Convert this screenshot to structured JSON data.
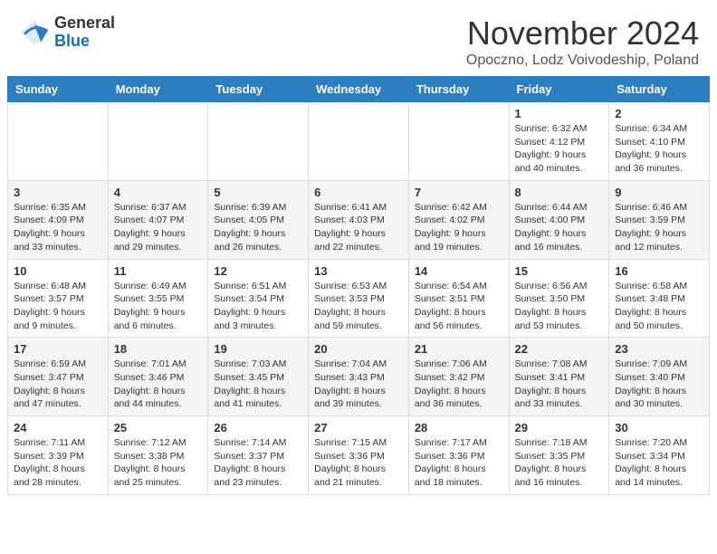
{
  "logo": {
    "general": "General",
    "blue": "Blue"
  },
  "header": {
    "title": "November 2024",
    "subtitle": "Opoczno, Lodz Voivodeship, Poland"
  },
  "columns": [
    "Sunday",
    "Monday",
    "Tuesday",
    "Wednesday",
    "Thursday",
    "Friday",
    "Saturday"
  ],
  "weeks": [
    [
      {
        "day": "",
        "info": ""
      },
      {
        "day": "",
        "info": ""
      },
      {
        "day": "",
        "info": ""
      },
      {
        "day": "",
        "info": ""
      },
      {
        "day": "",
        "info": ""
      },
      {
        "day": "1",
        "info": "Sunrise: 6:32 AM\nSunset: 4:12 PM\nDaylight: 9 hours\nand 40 minutes."
      },
      {
        "day": "2",
        "info": "Sunrise: 6:34 AM\nSunset: 4:10 PM\nDaylight: 9 hours\nand 36 minutes."
      }
    ],
    [
      {
        "day": "3",
        "info": "Sunrise: 6:35 AM\nSunset: 4:09 PM\nDaylight: 9 hours\nand 33 minutes."
      },
      {
        "day": "4",
        "info": "Sunrise: 6:37 AM\nSunset: 4:07 PM\nDaylight: 9 hours\nand 29 minutes."
      },
      {
        "day": "5",
        "info": "Sunrise: 6:39 AM\nSunset: 4:05 PM\nDaylight: 9 hours\nand 26 minutes."
      },
      {
        "day": "6",
        "info": "Sunrise: 6:41 AM\nSunset: 4:03 PM\nDaylight: 9 hours\nand 22 minutes."
      },
      {
        "day": "7",
        "info": "Sunrise: 6:42 AM\nSunset: 4:02 PM\nDaylight: 9 hours\nand 19 minutes."
      },
      {
        "day": "8",
        "info": "Sunrise: 6:44 AM\nSunset: 4:00 PM\nDaylight: 9 hours\nand 16 minutes."
      },
      {
        "day": "9",
        "info": "Sunrise: 6:46 AM\nSunset: 3:59 PM\nDaylight: 9 hours\nand 12 minutes."
      }
    ],
    [
      {
        "day": "10",
        "info": "Sunrise: 6:48 AM\nSunset: 3:57 PM\nDaylight: 9 hours\nand 9 minutes."
      },
      {
        "day": "11",
        "info": "Sunrise: 6:49 AM\nSunset: 3:55 PM\nDaylight: 9 hours\nand 6 minutes."
      },
      {
        "day": "12",
        "info": "Sunrise: 6:51 AM\nSunset: 3:54 PM\nDaylight: 9 hours\nand 3 minutes."
      },
      {
        "day": "13",
        "info": "Sunrise: 6:53 AM\nSunset: 3:53 PM\nDaylight: 8 hours\nand 59 minutes."
      },
      {
        "day": "14",
        "info": "Sunrise: 6:54 AM\nSunset: 3:51 PM\nDaylight: 8 hours\nand 56 minutes."
      },
      {
        "day": "15",
        "info": "Sunrise: 6:56 AM\nSunset: 3:50 PM\nDaylight: 8 hours\nand 53 minutes."
      },
      {
        "day": "16",
        "info": "Sunrise: 6:58 AM\nSunset: 3:48 PM\nDaylight: 8 hours\nand 50 minutes."
      }
    ],
    [
      {
        "day": "17",
        "info": "Sunrise: 6:59 AM\nSunset: 3:47 PM\nDaylight: 8 hours\nand 47 minutes."
      },
      {
        "day": "18",
        "info": "Sunrise: 7:01 AM\nSunset: 3:46 PM\nDaylight: 8 hours\nand 44 minutes."
      },
      {
        "day": "19",
        "info": "Sunrise: 7:03 AM\nSunset: 3:45 PM\nDaylight: 8 hours\nand 41 minutes."
      },
      {
        "day": "20",
        "info": "Sunrise: 7:04 AM\nSunset: 3:43 PM\nDaylight: 8 hours\nand 39 minutes."
      },
      {
        "day": "21",
        "info": "Sunrise: 7:06 AM\nSunset: 3:42 PM\nDaylight: 8 hours\nand 36 minutes."
      },
      {
        "day": "22",
        "info": "Sunrise: 7:08 AM\nSunset: 3:41 PM\nDaylight: 8 hours\nand 33 minutes."
      },
      {
        "day": "23",
        "info": "Sunrise: 7:09 AM\nSunset: 3:40 PM\nDaylight: 8 hours\nand 30 minutes."
      }
    ],
    [
      {
        "day": "24",
        "info": "Sunrise: 7:11 AM\nSunset: 3:39 PM\nDaylight: 8 hours\nand 28 minutes."
      },
      {
        "day": "25",
        "info": "Sunrise: 7:12 AM\nSunset: 3:38 PM\nDaylight: 8 hours\nand 25 minutes."
      },
      {
        "day": "26",
        "info": "Sunrise: 7:14 AM\nSunset: 3:37 PM\nDaylight: 8 hours\nand 23 minutes."
      },
      {
        "day": "27",
        "info": "Sunrise: 7:15 AM\nSunset: 3:36 PM\nDaylight: 8 hours\nand 21 minutes."
      },
      {
        "day": "28",
        "info": "Sunrise: 7:17 AM\nSunset: 3:36 PM\nDaylight: 8 hours\nand 18 minutes."
      },
      {
        "day": "29",
        "info": "Sunrise: 7:18 AM\nSunset: 3:35 PM\nDaylight: 8 hours\nand 16 minutes."
      },
      {
        "day": "30",
        "info": "Sunrise: 7:20 AM\nSunset: 3:34 PM\nDaylight: 8 hours\nand 14 minutes."
      }
    ]
  ]
}
